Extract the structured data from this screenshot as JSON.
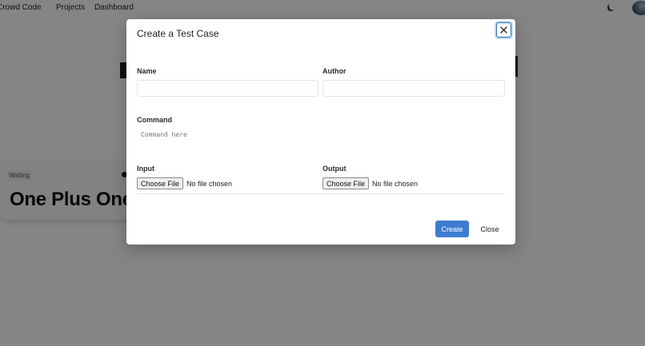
{
  "navbar": {
    "brand": "Crowd Code",
    "links": [
      "Projects",
      "Dashboard"
    ],
    "theme_icon": "moon-icon",
    "avatar_icon": "user-avatar"
  },
  "background": {
    "card": {
      "status": "Waiting",
      "title": "One Plus One"
    }
  },
  "modal": {
    "title": "Create a Test Case",
    "close_icon": "close-icon",
    "name_label": "Name",
    "name_value": "",
    "author_label": "Author",
    "author_value": "",
    "command_label": "Command",
    "command_placeholder": "Command here",
    "input_label": "Input",
    "output_label": "Output",
    "choose_file_label": "Choose File",
    "no_file_text": "No file chosen",
    "create_label": "Create",
    "close_label": "Close"
  },
  "colors": {
    "primary": "#3d7ccf",
    "overlay": "rgba(0,0,0,0.48)"
  }
}
